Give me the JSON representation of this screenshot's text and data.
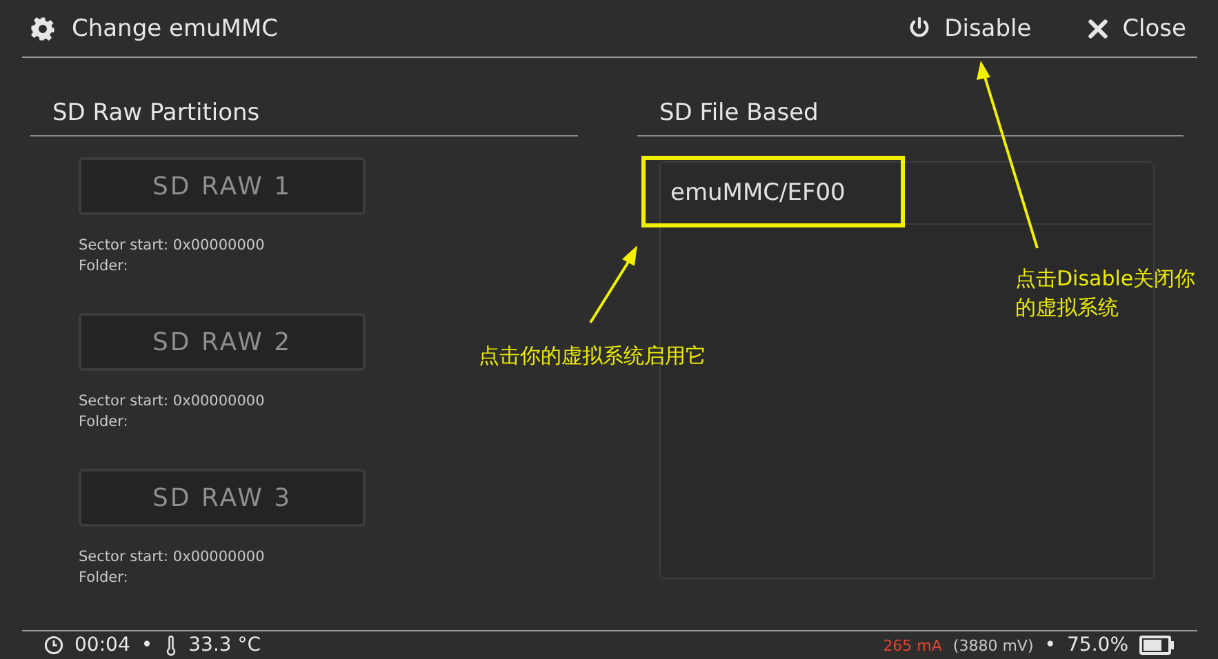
{
  "header": {
    "title": "Change emuMMC",
    "actions": [
      {
        "kind": "power",
        "label": "Disable"
      },
      {
        "kind": "close",
        "label": "Close"
      }
    ]
  },
  "raw": {
    "title": "SD Raw Partitions",
    "partitions": [
      {
        "label": "SD RAW 1",
        "sector": "Sector start: 0x00000000",
        "folder": "Folder:"
      },
      {
        "label": "SD RAW 2",
        "sector": "Sector start: 0x00000000",
        "folder": "Folder:"
      },
      {
        "label": "SD RAW 3",
        "sector": "Sector start: 0x00000000",
        "folder": "Folder:"
      }
    ]
  },
  "file": {
    "title": "SD File Based",
    "items": [
      {
        "label": "emuMMC/EF00",
        "highlighted": true
      }
    ]
  },
  "status_bar": {
    "left": [
      {
        "kind": "clock",
        "text": "00:04"
      },
      {
        "kind": "thermometer",
        "text": "33.3 °C"
      }
    ],
    "current": "265 mA",
    "voltage": "(3880 mV)",
    "separator": "•",
    "battery": "75.0%"
  },
  "annotations": [
    {
      "text": "点击你的虚拟系统启用它"
    },
    {
      "text": "点击Disable关闭你的虚拟系统"
    }
  ]
}
